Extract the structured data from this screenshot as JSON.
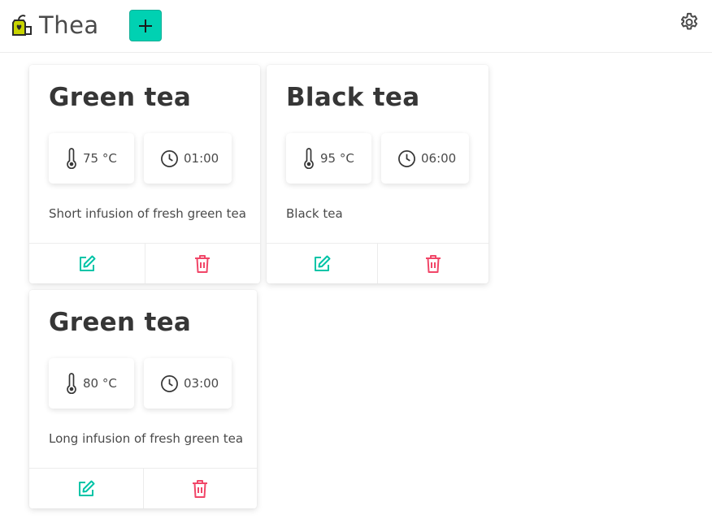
{
  "app": {
    "name": "Thea"
  },
  "colors": {
    "accent": "#00d1b2",
    "delete": "#f14668",
    "text": "#363636"
  },
  "icons": {
    "logo": "tea-bag-icon",
    "add": "plus-icon",
    "settings": "gear-icon",
    "temperature": "thermometer-icon",
    "time": "clock-icon",
    "edit": "edit-icon",
    "delete": "trash-icon"
  },
  "teas": [
    {
      "name": "Green tea",
      "temperature": "75 °C",
      "time": "01:00",
      "description": "Short infusion of fresh green tea"
    },
    {
      "name": "Black tea",
      "temperature": "95 °C",
      "time": "06:00",
      "description": "Black tea"
    },
    {
      "name": "Green tea",
      "temperature": "80 °C",
      "time": "03:00",
      "description": "Long infusion of fresh green tea"
    }
  ]
}
